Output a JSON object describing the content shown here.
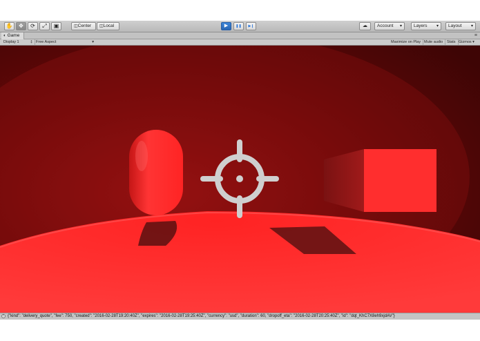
{
  "toolbar": {
    "tools": [
      {
        "name": "hand-tool-button",
        "icon": "hand-icon",
        "glyph": "✋",
        "active": false
      },
      {
        "name": "move-tool-button",
        "icon": "move-icon",
        "glyph": "✥",
        "active": true
      },
      {
        "name": "rotate-tool-button",
        "icon": "rotate-icon",
        "glyph": "⟳",
        "active": false
      },
      {
        "name": "scale-tool-button",
        "icon": "scale-icon",
        "glyph": "⤢",
        "active": false
      },
      {
        "name": "rect-tool-button",
        "icon": "rect-icon",
        "glyph": "▣",
        "active": false
      }
    ],
    "pivot_label": "Center",
    "space_label": "Local",
    "play_controls": [
      {
        "name": "play-button",
        "icon": "play-icon",
        "glyph": "▶",
        "active": true
      },
      {
        "name": "pause-button",
        "icon": "pause-icon",
        "glyph": "❚❚",
        "active": false
      },
      {
        "name": "step-button",
        "icon": "step-icon",
        "glyph": "▶❙",
        "active": false
      }
    ],
    "cloud_icon": "cloud-icon",
    "account_label": "Account",
    "layers_label": "Layers",
    "layout_label": "Layout"
  },
  "game_tab": {
    "label": "Game",
    "icon": "game-icon"
  },
  "game_bar": {
    "display_label": "Display 1",
    "aspect_label": "Free Aspect",
    "maximize_label": "Maximize on Play",
    "mute_label": "Mute audio",
    "stats_label": "Stats",
    "gizmos_label": "Gizmos"
  },
  "scene": {
    "crosshair_icon": "crosshair-icon",
    "colors": {
      "background": "#5a0606",
      "floor": "#ff2a2a",
      "capsule": "#ff2b2b",
      "cube_front": "#ff3030",
      "cube_side": "#8a1515",
      "crosshair": "#cfcfcf"
    }
  },
  "console": {
    "icon": "info-icon",
    "message": "{\"kind\": \"delivery_quote\", \"fee\": 750, \"created\": \"2016-02-28T19:20:40Z\", \"expires\": \"2016-02-28T19:25:40Z\", \"currency\": \"usd\", \"duration\": 60, \"dropoff_eta\": \"2016-02-28T20:25:40Z\", \"id\": \"dqt_KhC7X8eh9xjdAV\"}"
  }
}
